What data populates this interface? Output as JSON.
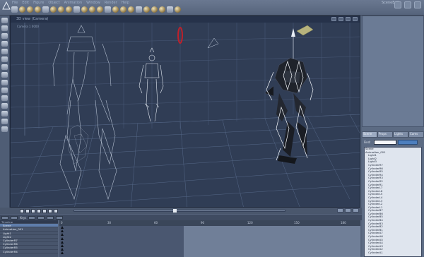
{
  "app": {
    "menus": [
      "File",
      "Edit",
      "Figure",
      "Object",
      "Animation",
      "Window",
      "Render",
      "Help"
    ],
    "scene_label": "SceneEdit"
  },
  "viewport": {
    "title": "3D view (Camera)",
    "camera_label": "Camera 1 0000"
  },
  "right_panel": {
    "tabs": [
      "Scene",
      "Props",
      "Lights",
      "Cams"
    ],
    "find_label": "Find:",
    "find_value": "",
    "list_items": [
      "Scene",
      "Animation_001",
      "Light1",
      "Light2",
      "Light3",
      "CylinderR7",
      "CylinderR6",
      "CylinderR5",
      "CylinderR4",
      "CylinderR3",
      "CylinderR2",
      "CylinderR1",
      "CylinderL7",
      "CylinderL6",
      "CylinderL5",
      "CylinderL4",
      "CylinderL3",
      "CylinderL2",
      "CylinderL1",
      "CylinderB7",
      "CylinderB6",
      "CylinderB5",
      "CylinderB4",
      "CylinderB3",
      "CylinderB2",
      "CylinderB1",
      "CylinderA7",
      "CylinderA6",
      "CylinderA5",
      "CylinderA4",
      "CylinderA3",
      "CylinderA2",
      "CylinderA1"
    ]
  },
  "timeline": {
    "key_label": "Keys",
    "track_header": "Timeline",
    "tracks": [
      "Scene",
      "Animation_001",
      "Light1",
      "Light2",
      "CylinderR7",
      "CylinderR6",
      "CylinderR5",
      "CylinderR4"
    ],
    "frame_labels": [
      "0",
      "30",
      "60",
      "90",
      "120",
      "150",
      "180"
    ]
  },
  "colors": {
    "accent": "#4d7fbe",
    "viewport_bg": "#303d55",
    "ring": "#c0202a"
  }
}
